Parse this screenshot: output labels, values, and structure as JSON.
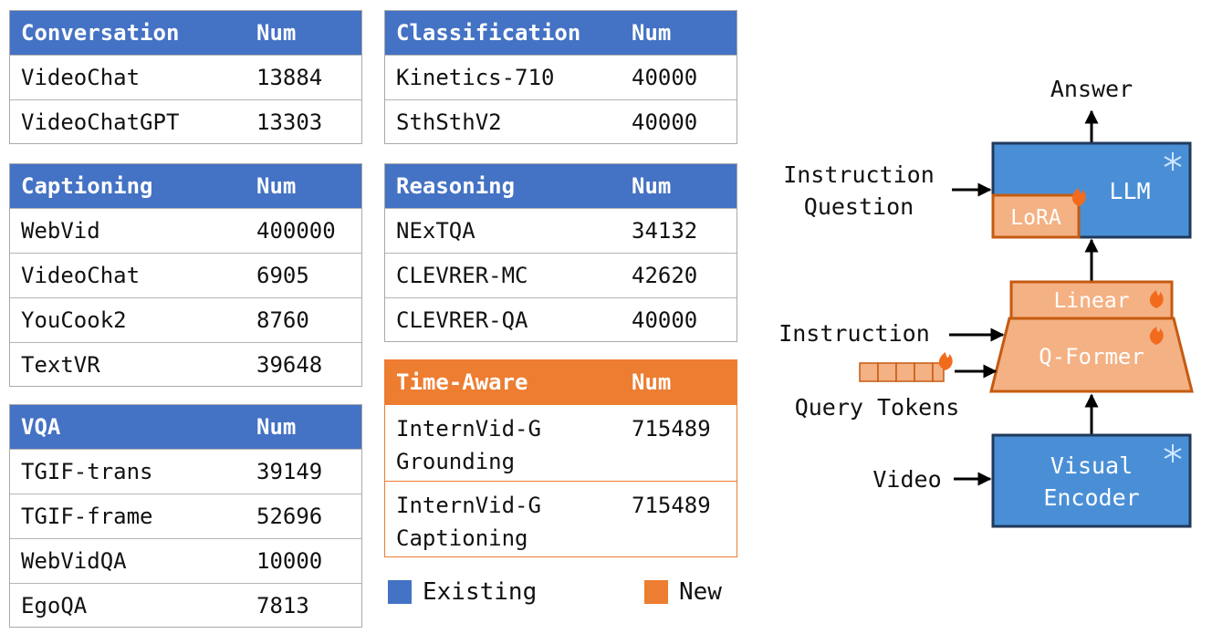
{
  "colors": {
    "existing": "#4472c4",
    "new": "#ed7d31",
    "box_blue": "#4a8fd6",
    "box_orange": "#f4b183",
    "border_dark": "#1f3a5a",
    "border_orange": "#c55a11"
  },
  "tables": {
    "conversation": {
      "header": "Conversation",
      "num_label": "Num",
      "rows": [
        {
          "name": "VideoChat",
          "num": "13884"
        },
        {
          "name": "VideoChatGPT",
          "num": "13303"
        }
      ]
    },
    "captioning": {
      "header": "Captioning",
      "num_label": "Num",
      "rows": [
        {
          "name": "WebVid",
          "num": "400000"
        },
        {
          "name": "VideoChat",
          "num": "6905"
        },
        {
          "name": "YouCook2",
          "num": "8760"
        },
        {
          "name": "TextVR",
          "num": "39648"
        }
      ]
    },
    "vqa": {
      "header": "VQA",
      "num_label": "Num",
      "rows": [
        {
          "name": "TGIF-trans",
          "num": "39149"
        },
        {
          "name": "TGIF-frame",
          "num": "52696"
        },
        {
          "name": "WebVidQA",
          "num": "10000"
        },
        {
          "name": "EgoQA",
          "num": "7813"
        }
      ]
    },
    "classification": {
      "header": "Classification",
      "num_label": "Num",
      "rows": [
        {
          "name": "Kinetics-710",
          "num": "40000"
        },
        {
          "name": "SthSthV2",
          "num": "40000"
        }
      ]
    },
    "reasoning": {
      "header": "Reasoning",
      "num_label": "Num",
      "rows": [
        {
          "name": "NExTQA",
          "num": "34132"
        },
        {
          "name": "CLEVRER-MC",
          "num": "42620"
        },
        {
          "name": "CLEVRER-QA",
          "num": "40000"
        }
      ]
    },
    "time_aware": {
      "header": "Time-Aware",
      "num_label": "Num",
      "rows": [
        {
          "name": "InternVid-G Grounding",
          "num": "715489"
        },
        {
          "name": "InternVid-G Captioning",
          "num": "715489"
        }
      ]
    }
  },
  "legend": {
    "existing": "Existing",
    "new": "New"
  },
  "diagram": {
    "answer": "Answer",
    "instruction_question_1": "Instruction",
    "instruction_question_2": "Question",
    "llm": "LLM",
    "lora": "LoRA",
    "linear": "Linear",
    "instruction": "Instruction",
    "qformer": "Q-Former",
    "query_tokens": "Query Tokens",
    "video": "Video",
    "visual_encoder_1": "Visual",
    "visual_encoder_2": "Encoder",
    "fire_icon": "fire-icon",
    "snowflake_icon": "snowflake-icon"
  }
}
